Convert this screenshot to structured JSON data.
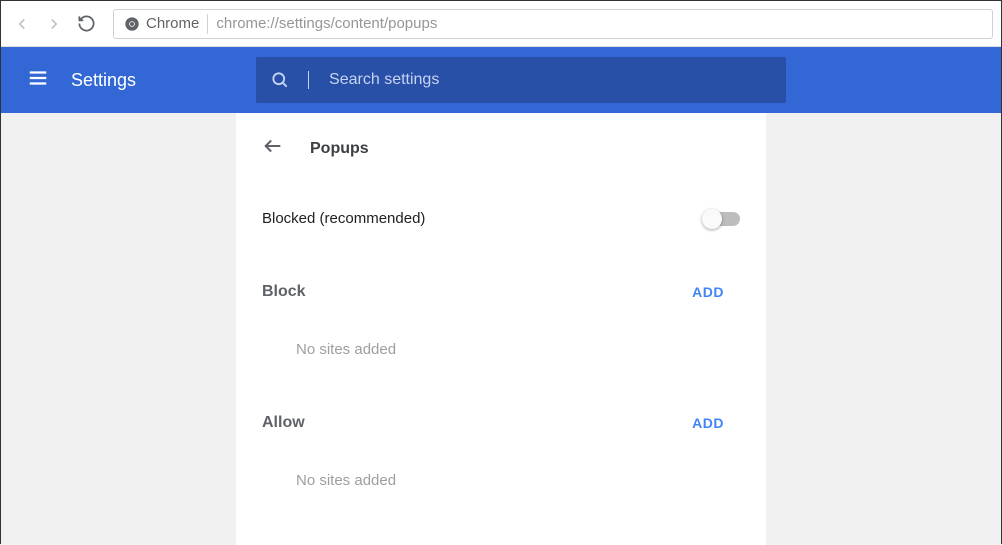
{
  "browser": {
    "label": "Chrome",
    "url": "chrome://settings/content/popups"
  },
  "header": {
    "title": "Settings",
    "search_placeholder": "Search settings"
  },
  "page": {
    "title": "Popups",
    "toggle_label": "Blocked (recommended)",
    "toggle_on": false,
    "sections": {
      "block": {
        "title": "Block",
        "add_label": "ADD",
        "empty": "No sites added"
      },
      "allow": {
        "title": "Allow",
        "add_label": "ADD",
        "empty": "No sites added"
      }
    }
  },
  "colors": {
    "brand": "#3367d6",
    "search_bg": "#2850a7",
    "content_bg": "#f1f1f1",
    "accent": "#4285f4"
  }
}
